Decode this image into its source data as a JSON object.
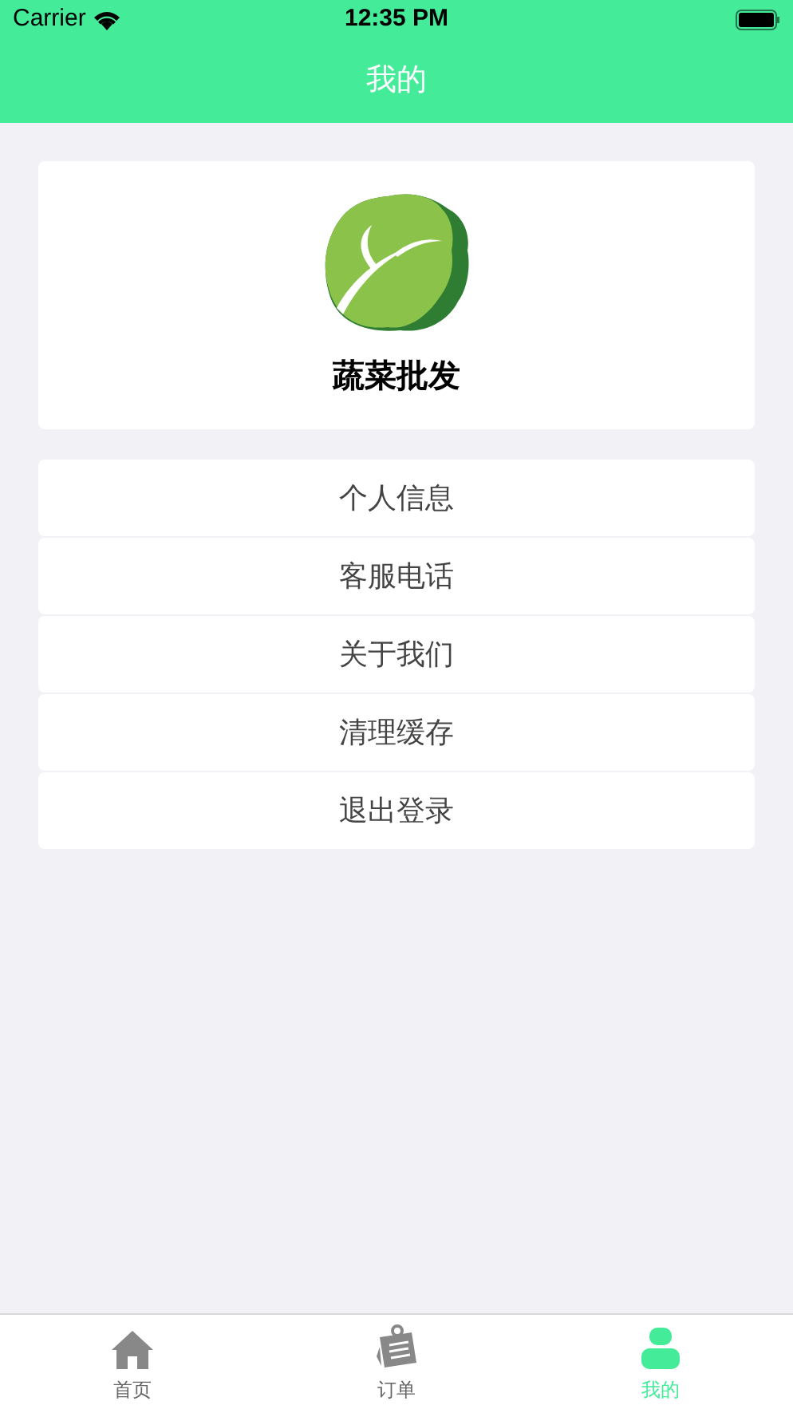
{
  "status_bar": {
    "carrier": "Carrier",
    "time": "12:35 PM"
  },
  "nav_bar": {
    "title": "我的"
  },
  "profile": {
    "name": "蔬菜批发"
  },
  "menu": [
    {
      "label": "个人信息"
    },
    {
      "label": "客服电话"
    },
    {
      "label": "关于我们"
    },
    {
      "label": "清理缓存"
    },
    {
      "label": "退出登录"
    }
  ],
  "tab_bar": [
    {
      "label": "首页",
      "kind": "home",
      "selected": false
    },
    {
      "label": "订单",
      "kind": "orders",
      "selected": false
    },
    {
      "label": "我的",
      "kind": "profile",
      "selected": true
    }
  ]
}
